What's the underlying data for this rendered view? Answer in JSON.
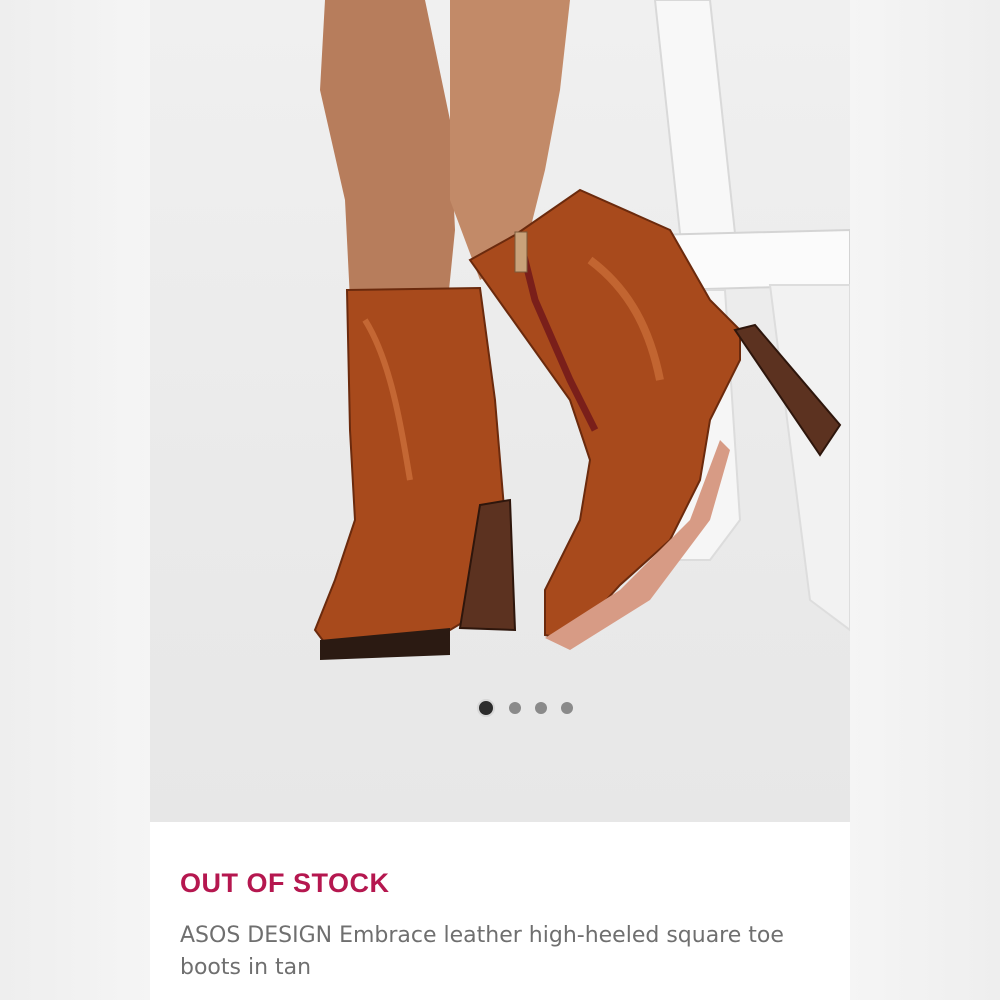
{
  "product": {
    "image_alt": "Tan leather square toe heeled ankle boots",
    "stock_status": "OUT OF STOCK",
    "title": "ASOS DESIGN Embrace leather high-heeled square toe boots in tan"
  },
  "gallery": {
    "total_images": 4,
    "active_index": 1
  },
  "colors": {
    "stock_status": "#b5174f",
    "boot_leather": "#a84a1c",
    "heel_wood": "#5c3220"
  }
}
